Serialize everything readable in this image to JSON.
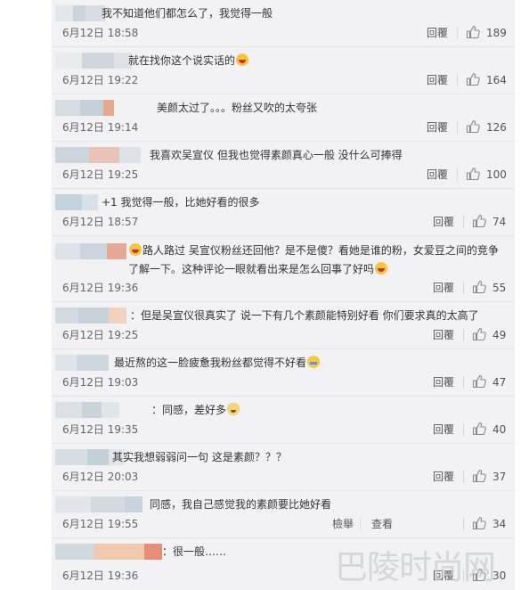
{
  "comments": [
    {
      "text": "我不知道他们都怎么了，我觉得一般",
      "time": "6月12日 18:58",
      "reply": "回覆",
      "likes": "189",
      "avatar_colors": [
        "#e3e6ea",
        "#c9d4dc",
        "#d7dde2"
      ]
    },
    {
      "text": "就在找你这个说实话的",
      "emoji": "laugh",
      "time": "6月12日 19:22",
      "reply": "回覆",
      "likes": "164",
      "avatar_colors": [
        "#e9ecef",
        "#cfd6dd",
        "#dde2e6"
      ]
    },
    {
      "text": "美颜太过了。。。粉丝又吹的太夸张",
      "time": "6月12日 19:14",
      "reply": "回覆",
      "likes": "126",
      "avatar_colors": [
        "#d5dce2",
        "#c6d0d9",
        "#e7a98e"
      ]
    },
    {
      "text": "我喜欢吴宣仪  但我也觉得素颜真心一般  没什么可捧得",
      "time": "6月12日 19:25",
      "reply": "回覆",
      "likes": "100",
      "avatar_colors": [
        "#cdd6de",
        "#e9c3b6",
        "#dde2e7"
      ]
    },
    {
      "text": "+1 我觉得一般，比她好看的很多",
      "time": "6月12日 18:57",
      "reply": "回覆",
      "likes": "74",
      "avatar_colors": [
        "#c5d3df",
        "#d8e1e8"
      ]
    },
    {
      "text_before": "路人路过 吴宣仪粉丝还回他？是不是傻？看她是谁的粉，女爱豆之间的竞争了解一下。这种评论一眼就看出来是怎么回事了好吗",
      "emoji": "laugh",
      "time": "6月12日 19:36",
      "reply": "回覆",
      "likes": "55",
      "avatar_colors": [
        "#dde3e8",
        "#cdd6de",
        "#e6a996"
      ]
    },
    {
      "text": "：但是吴宣仪很真实了  说一下有几个素颜能特别好看  你们要求真的太高了",
      "time": "6月12日 19:25",
      "reply": "回覆",
      "likes": "49",
      "avatar_colors": [
        "#d2dbe2",
        "#c7d2db",
        "#f1d3bf"
      ]
    },
    {
      "text": "最近熬的这一脸疲惫我粉丝都觉得不好看",
      "emoji": "sweat",
      "time": "6月12日 19:03",
      "reply": "回覆",
      "likes": "47",
      "avatar_colors": [
        "#dfe4e9",
        "#cfd8df"
      ]
    },
    {
      "text": "：同感，差好多",
      "emoji": "dog",
      "time": "6月12日 19:35",
      "reply": "回覆",
      "likes": "40",
      "avatar_colors": [
        "#dbe1e6",
        "#c9d3dc",
        "#e1e6ea"
      ]
    },
    {
      "text": "其实我想弱弱问一句 这是素颜？？？",
      "time": "6月12日 20:03",
      "reply": "回覆",
      "likes": "37",
      "avatar_colors": [
        "#d6dee4",
        "#c3cfd9",
        "#e0e5e9"
      ]
    },
    {
      "text": "同感，我自己感觉我的素颜要比她好看",
      "time": "6月12日 19:55",
      "report": "檢舉",
      "view": "查看",
      "likes": "34",
      "avatar_colors": [
        "#e2e6ea",
        "#d3dbe1",
        "#c9d3dc"
      ]
    },
    {
      "text": "：很一般……",
      "time": "6月12日 19:36",
      "reply": "回覆",
      "likes": "30",
      "avatar_colors": [
        "#d0d9e0",
        "#f0c9ae",
        "#e58f78"
      ]
    }
  ],
  "watermark": "巴陵时尚网",
  "colors": {
    "panel": "#f2f2f5",
    "divider": "#e3e3e7",
    "text": "#333333",
    "meta": "#666666"
  }
}
